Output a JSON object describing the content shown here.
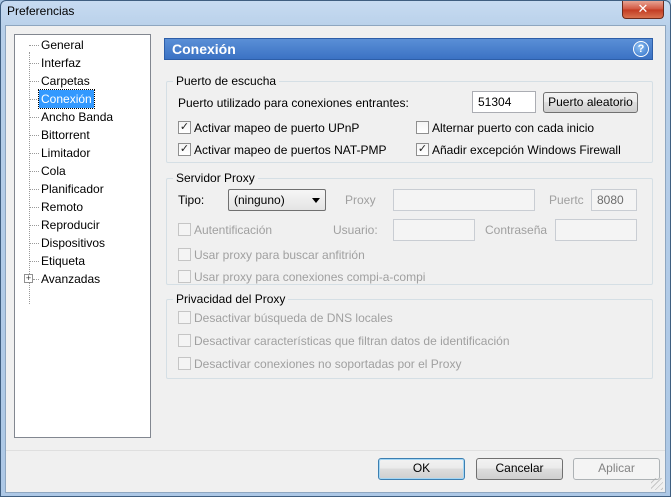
{
  "window": {
    "title": "Preferencias",
    "close_glyph": "✕"
  },
  "tree": {
    "items": [
      {
        "label": "General"
      },
      {
        "label": "Interfaz"
      },
      {
        "label": "Carpetas"
      },
      {
        "label": "Conexión",
        "selected": true
      },
      {
        "label": "Ancho Banda"
      },
      {
        "label": "Bittorrent"
      },
      {
        "label": "Limitador"
      },
      {
        "label": "Cola"
      },
      {
        "label": "Planificador"
      },
      {
        "label": "Remoto"
      },
      {
        "label": "Reproducir"
      },
      {
        "label": "Dispositivos"
      },
      {
        "label": "Etiqueta"
      },
      {
        "label": "Avanzadas",
        "expandable": true
      }
    ],
    "expand_glyph": "+"
  },
  "panel": {
    "title": "Conexión",
    "help_glyph": "?"
  },
  "listening_port": {
    "title": "Puerto de escucha",
    "port_label": "Puerto utilizado para conexiones entrantes:",
    "port_value": "51304",
    "random_button": "Puerto aleatorio",
    "upnp_label": "Activar mapeo de puerto UPnP",
    "upnp_checked": true,
    "natpmp_label": "Activar mapeo de puertos NAT-PMP",
    "natpmp_checked": true,
    "alternate_label": "Alternar puerto con cada inicio",
    "alternate_checked": false,
    "firewall_label": "Añadir excepción Windows Firewall",
    "firewall_checked": true
  },
  "proxy_server": {
    "title": "Servidor Proxy",
    "type_label": "Tipo:",
    "type_value": "(ninguno)",
    "proxy_label": "Proxy",
    "proxy_value": "",
    "port_label": "Puertc",
    "port_value": "8080",
    "auth_label": "Autentificación",
    "user_label": "Usuario:",
    "user_value": "",
    "password_label": "Contraseña",
    "password_value": "",
    "hostname_label": "Usar proxy para buscar anfitrión",
    "p2p_label": "Usar proxy para conexiones compi-a-compi"
  },
  "proxy_privacy": {
    "title": "Privacidad del Proxy",
    "dns_label": "Desactivar búsqueda de DNS locales",
    "identify_label": "Desactivar características que filtran datos de identificación",
    "unsupported_label": "Desactivar conexiones no soportadas por el Proxy"
  },
  "footer": {
    "ok": "OK",
    "cancel": "Cancelar",
    "apply": "Aplicar"
  },
  "check_glyph": "✓"
}
